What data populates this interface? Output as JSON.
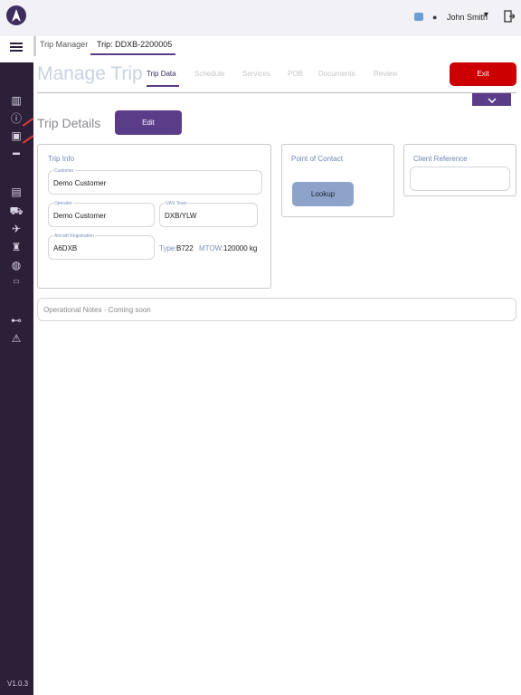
{
  "header": {
    "user_name": "John Smith",
    "user_icon": "person-icon",
    "globe_icon": "globe-icon",
    "logout_icon": "logout-icon",
    "chevron": "▾"
  },
  "breadcrumb": {
    "items": [
      {
        "label": "Trip Manager"
      },
      {
        "label": "Trip: DDXB-2200005"
      }
    ]
  },
  "page": {
    "title": "Manage Trip",
    "tabs": [
      {
        "label": "Trip Data",
        "active": true
      },
      {
        "label": "Schedule"
      },
      {
        "label": "Services"
      },
      {
        "label": "POB"
      },
      {
        "label": "Documents"
      },
      {
        "label": "Review"
      }
    ],
    "exit_label": "Exit",
    "collapse_glyph": "⌄"
  },
  "trip_details": {
    "title": "Trip Details",
    "edit_label": "Edit",
    "trip_info": {
      "title": "Trip Info",
      "customer_label": "Customer",
      "customer_value": "Demo Customer",
      "operator_label": "Operator",
      "operator_value": "Demo Customer",
      "uas_team_label": "UAS Team",
      "uas_team_value": "DXB/YLW",
      "aircraft_reg_label": "Aircraft Registration",
      "aircraft_reg_value": "A6DXB",
      "type_label": "Type:",
      "type_value": "B722",
      "mtow_label": "MTOW:",
      "mtow_value": "120000 kg"
    },
    "point_of_contact": {
      "title": "Point of Contact",
      "lookup_label": "Lookup"
    },
    "client_reference": {
      "title": "Client Reference",
      "value": ""
    },
    "operational_notes": "Operational Notes - Coming soon"
  },
  "sidebar": {
    "version": "V1.0.3",
    "icons": [
      "map-icon",
      "info-icon",
      "briefcase-icon",
      "car-icon",
      "contact-icon",
      "vehicle-icon",
      "plane-icon",
      "tower-icon",
      "globe-icon",
      "document-icon",
      "connector-icon",
      "warning-icon"
    ]
  },
  "colors": {
    "sidebar": "#2b2038",
    "accent": "#5b3c88",
    "exit": "#cc0000",
    "lookup": "#8ea3c9"
  }
}
